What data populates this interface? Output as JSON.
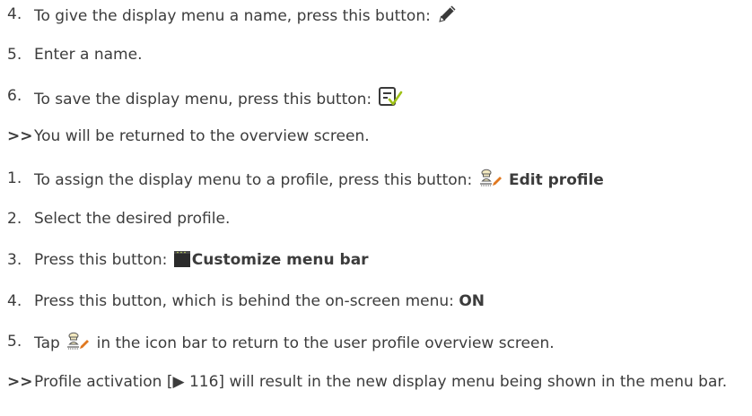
{
  "steps": [
    {
      "marker": "4.",
      "text": "To give the display menu a name, press this button:",
      "icon": "pencil-icon"
    },
    {
      "marker": "5.",
      "text": "Enter a name."
    },
    {
      "marker": "6.",
      "text": "To save the display menu, press this button:",
      "icon": "save-checklist-icon"
    },
    {
      "marker": ">>",
      "text": "You will be returned to the overview screen."
    },
    {
      "marker": "1.",
      "text": "To assign the display menu to a profile, press this button:",
      "icon": "chef-profile-edit-icon",
      "bold": "Edit profile"
    },
    {
      "marker": "2.",
      "text": "Select the desired profile."
    },
    {
      "marker": "3.",
      "text": "Press this button:",
      "icon": "oven-icon",
      "bold": "Customize menu bar"
    },
    {
      "marker": "4.",
      "text": "Press this button, which is behind the on-screen menu:",
      "bold": "ON"
    },
    {
      "marker": "5.",
      "text_before": "Tap",
      "icon": "chef-profile-edit-icon",
      "text_after": "in the icon bar to return to the user profile overview screen."
    },
    {
      "marker": ">>",
      "text": "Profile activation [▶ 116] will result in the new display menu being shown in the menu bar."
    }
  ],
  "colors": {
    "text": "#3c3c3c",
    "icon_dark": "#3a3a3a",
    "check_green": "#a0c218",
    "hat_fill": "#f3e9c0"
  }
}
